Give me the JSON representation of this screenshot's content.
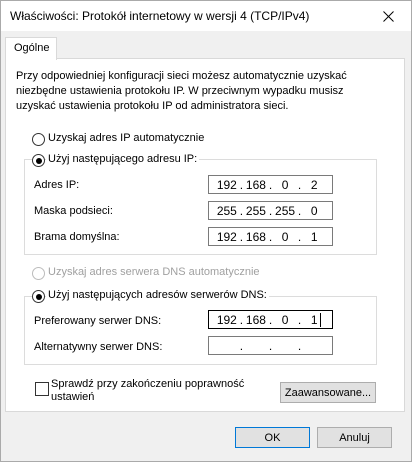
{
  "window": {
    "title": "Właściwości: Protokół internetowy w wersji 4 (TCP/IPv4)"
  },
  "tabs": [
    {
      "label": "Ogólne"
    }
  ],
  "description": "Przy odpowiedniej konfiguracji sieci możesz automatycznie uzyskać niezbędne ustawienia protokołu IP. W przeciwnym wypadku musisz uzyskać ustawienia protokołu IP od administratora sieci.",
  "ip": {
    "auto_label": "Uzyskaj adres IP automatycznie",
    "manual_label": "Użyj następującego adresu IP:",
    "selected": "manual",
    "address_label": "Adres IP:",
    "address": [
      "192",
      "168",
      "0",
      "2"
    ],
    "mask_label": "Maska podsieci:",
    "mask": [
      "255",
      "255",
      "255",
      "0"
    ],
    "gateway_label": "Brama domyślna:",
    "gateway": [
      "192",
      "168",
      "0",
      "1"
    ]
  },
  "dns": {
    "auto_label": "Uzyskaj adres serwera DNS automatycznie",
    "manual_label": "Użyj następujących adresów serwerów DNS:",
    "selected": "manual",
    "preferred_label": "Preferowany serwer DNS:",
    "preferred": [
      "192",
      "168",
      "0",
      "1"
    ],
    "alternate_label": "Alternatywny serwer DNS:",
    "alternate": [
      "",
      "",
      "",
      ""
    ]
  },
  "validate_checkbox": {
    "label_line1": "Sprawdź przy zakończeniu poprawność",
    "label_line2": "ustawień",
    "checked": false
  },
  "buttons": {
    "advanced": "Zaawansowane...",
    "ok": "OK",
    "cancel": "Anuluj"
  },
  "icons": {
    "close": "close-icon"
  }
}
